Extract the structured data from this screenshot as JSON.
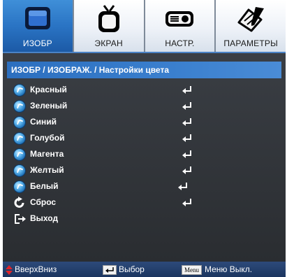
{
  "tabs": [
    {
      "label": "ИЗОБР",
      "icon": "monitor-icon",
      "active": true
    },
    {
      "label": "ЭКРАН",
      "icon": "tv-icon",
      "active": false
    },
    {
      "label": "НАСТР.",
      "icon": "projector-icon",
      "active": false
    },
    {
      "label": "ПАРАМЕТРЫ",
      "icon": "settings-pen-icon",
      "active": false
    }
  ],
  "breadcrumb": "ИЗОБР / ИЗОБРАЖ. / Настройки цвета",
  "menu": {
    "items": [
      {
        "label": "Красный",
        "icon": "bullet-icon",
        "action_icon": "enter-icon"
      },
      {
        "label": "Зеленый",
        "icon": "bullet-icon",
        "action_icon": "enter-icon"
      },
      {
        "label": "Синий",
        "icon": "bullet-icon",
        "action_icon": "enter-icon"
      },
      {
        "label": "Голубой",
        "icon": "bullet-icon",
        "action_icon": "enter-icon"
      },
      {
        "label": "Магента",
        "icon": "bullet-icon",
        "action_icon": "enter-icon"
      },
      {
        "label": "Желтый",
        "icon": "bullet-icon",
        "action_icon": "enter-icon"
      },
      {
        "label": "Белый",
        "icon": "bullet-icon",
        "action_icon": "enter-icon"
      },
      {
        "label": "Сброс",
        "icon": "reset-icon",
        "action_icon": "enter-icon"
      },
      {
        "label": "Выход",
        "icon": "exit-icon"
      }
    ]
  },
  "footer": {
    "nav_label": "ВверхВниз",
    "select_label": "Выбор",
    "menu_key": "Menu",
    "menu_off_label": "Меню Выкл."
  },
  "colors": {
    "active_tab": "#2a74c4",
    "panel_bg": "#2f3236",
    "breadcrumb_bg": "#3a7fce",
    "footer_bg": "#1b355f",
    "nav_arrow": "#e0242a"
  }
}
